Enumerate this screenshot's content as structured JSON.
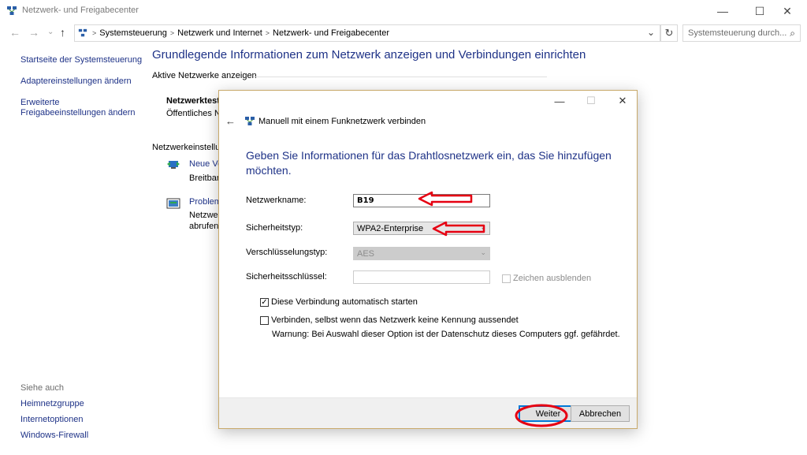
{
  "window": {
    "title": "Netzwerk- und Freigabecenter",
    "minimize": "—",
    "maximize": "☐",
    "close": "✕"
  },
  "nav": {
    "back": "←",
    "forward": "→",
    "up": "↑",
    "breadcrumbs": [
      "Systemsteuerung",
      "Netzwerk und Internet",
      "Netzwerk- und Freigabecenter"
    ],
    "dropdown": "⌄",
    "refresh": "↻",
    "search_placeholder": "Systemsteuerung durch...",
    "search_icon": "⌕"
  },
  "sidebar": {
    "links": [
      "Startseite der Systemsteuerung",
      "Adaptereinstellungen ändern",
      "Erweiterte Freigabeeinstellungen ändern"
    ],
    "see_also": "Siehe auch",
    "bottom_links": [
      "Heimnetzgruppe",
      "Internetoptionen",
      "Windows-Firewall"
    ]
  },
  "main": {
    "title": "Grundlegende Informationen zum Netzwerk anzeigen und Verbindungen einrichten",
    "active_label": "Aktive Netzwerke anzeigen",
    "network_name": "Netzwerktest",
    "network_type": "Öffentliches N",
    "settings_label": "Netzwerkeinstellun",
    "item1_link": "Neue Ve",
    "item1_text": "Breitban",
    "item2_link": "Problem",
    "item2_text1": "Netzwer",
    "item2_text2": "abrufen."
  },
  "dialog": {
    "minimize": "—",
    "maximize": "☐",
    "close": "✕",
    "back": "←",
    "title": "Manuell mit einem Funknetzwerk verbinden",
    "heading": "Geben Sie Informationen für das Drahtlosnetzwerk ein, das Sie hinzufügen möchten.",
    "network_name_label": "Netzwerkname:",
    "network_name_value": "B19",
    "security_type_label": "Sicherheitstyp:",
    "security_type_value": "WPA2-Enterprise",
    "encryption_label": "Verschlüsselungstyp:",
    "encryption_value": "AES",
    "key_label": "Sicherheitsschlüssel:",
    "key_value": "",
    "hide_chars_label": "Zeichen ausblenden",
    "auto_start_label": "Diese Verbindung automatisch starten",
    "auto_start_check": "✓",
    "connect_hidden_label": "Verbinden, selbst wenn das Netzwerk keine Kennung aussendet",
    "warning": "Warnung: Bei Auswahl dieser Option ist der Datenschutz dieses Computers ggf. gefährdet.",
    "next_button": "Weiter",
    "cancel_button": "Abbrechen",
    "chevron": "⌄"
  },
  "colors": {
    "link": "#1e3287",
    "annotation": "#e60012",
    "primary_border": "#0078d7"
  }
}
